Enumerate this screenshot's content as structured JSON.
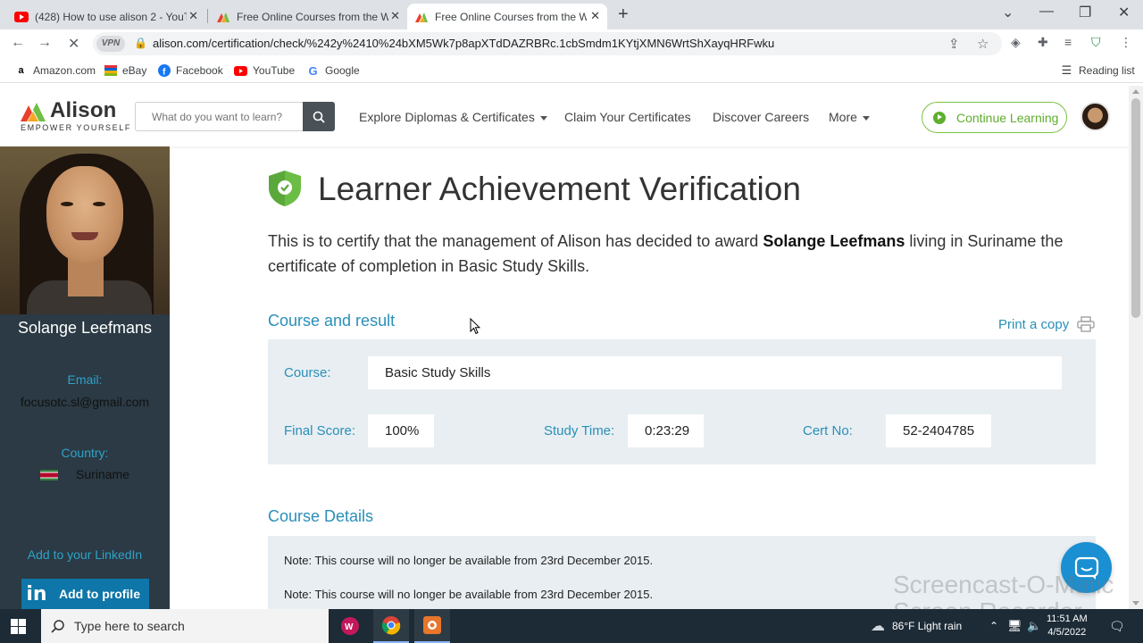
{
  "browser": {
    "tabs": [
      {
        "title": "(428) How to use alison 2 - YouTu",
        "active": false
      },
      {
        "title": "Free Online Courses from the Wo",
        "active": false
      },
      {
        "title": "Free Online Courses from the Wo",
        "active": true
      }
    ],
    "url": "alison.com/certification/check/%242y%2410%24bXM5Wk7p8apXTdDAZRBRc.1cbSmdm1KYtjXMN6WrtShXayqHRFwku",
    "vpn_label": "VPN",
    "bookmarks": [
      "Amazon.com",
      "eBay",
      "Facebook",
      "YouTube",
      "Google"
    ],
    "reading_list": "Reading list"
  },
  "site": {
    "logo_word": "Alison",
    "logo_tagline": "EMPOWER YOURSELF",
    "search_placeholder": "What do you want to learn?",
    "nav": {
      "explore": "Explore Diplomas & Certificates",
      "claim": "Claim Your Certificates",
      "careers": "Discover Careers",
      "more": "More"
    },
    "continue_learning": "Continue Learning"
  },
  "profile": {
    "name": "Solange Leefmans",
    "email_label": "Email:",
    "email": "focusotc.sl@gmail.com",
    "country_label": "Country:",
    "country": "Suriname",
    "linkedin_link": "Add to your LinkedIn",
    "linkedin_button": "Add to profile",
    "linkedin_logo": "in"
  },
  "main": {
    "title": "Learner Achievement Verification",
    "intro_before": "This is to certify that the management of Alison has decided to award ",
    "intro_name": "Solange Leefmans",
    "intro_after": " living in Suriname the certificate of completion in Basic Study Skills.",
    "course_result_heading": "Course and result",
    "print_label": "Print a copy",
    "course_label": "Course:",
    "course_value": "Basic Study Skills",
    "score_label": "Final Score:",
    "score_value": "100%",
    "time_label": "Study Time:",
    "time_value": "0:23:29",
    "cert_label": "Cert No:",
    "cert_value": "52-2404785",
    "details_heading": "Course Details",
    "notes": [
      "Note: This course will no longer be available from 23rd December 2015.",
      "Note: This course will no longer be available from 23rd December 2015."
    ]
  },
  "taskbar": {
    "search_placeholder": "Type here to search",
    "weather": "86°F  Light rain",
    "time": "11:51 AM",
    "date": "4/5/2022"
  },
  "watermark": {
    "line1": "Screencast-O-Matic",
    "line2": "Screen Recorder"
  },
  "colors": {
    "brand_blue": "#2a8fb8",
    "panel_dark": "#2b3a44",
    "continue_green": "#5fae2e",
    "linkedin": "#0e76a8"
  }
}
